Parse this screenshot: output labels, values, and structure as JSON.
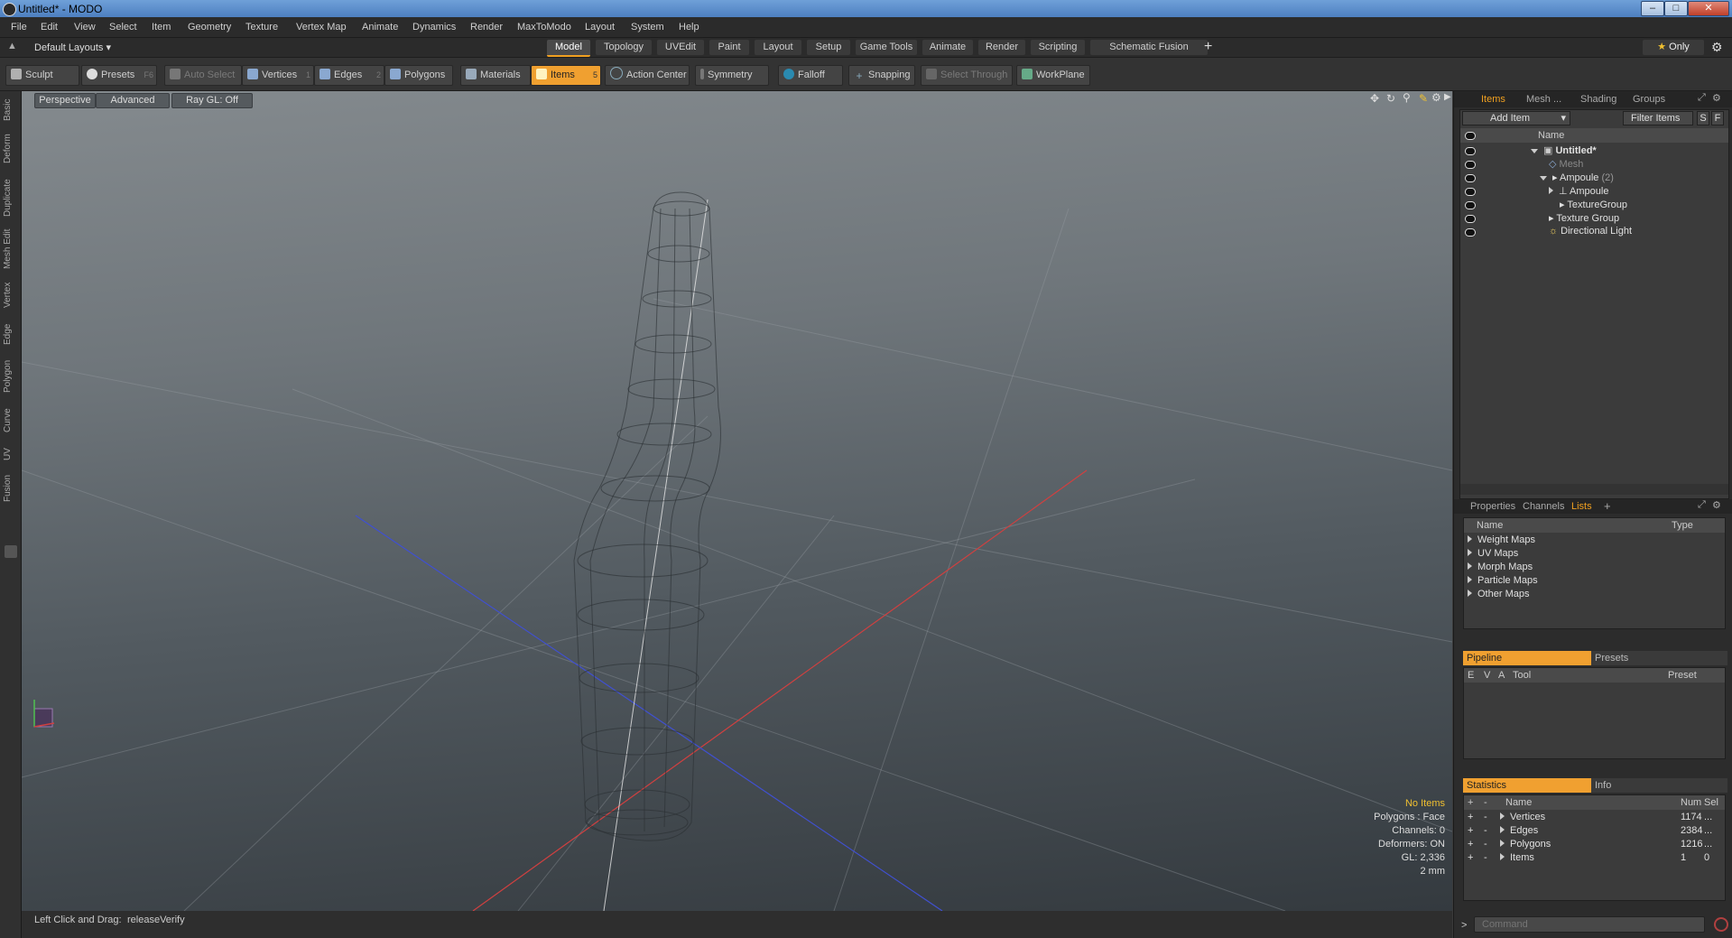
{
  "window": {
    "title": "Untitled* - MODO",
    "minimize": "–",
    "maximize": "□",
    "close": "✕"
  },
  "menu": [
    "File",
    "Edit",
    "View",
    "Select",
    "Item",
    "Geometry",
    "Texture",
    "Vertex Map",
    "Animate",
    "Dynamics",
    "Render",
    "MaxToModo",
    "Layout",
    "System",
    "Help"
  ],
  "layout_selector": "Default Layouts",
  "layout_tabs": [
    "Model",
    "Topology",
    "UVEdit",
    "Paint",
    "Layout",
    "Setup",
    "Game Tools",
    "Animate",
    "Render",
    "Scripting",
    "Schematic Fusion"
  ],
  "active_layout_tab": "Model",
  "only_button": "Only",
  "toolbar": {
    "sculpt": "Sculpt",
    "presets": "Presets",
    "presets_key": "F6",
    "auto_select": "Auto Select",
    "vertices": "Vertices",
    "vertices_key": "1",
    "edges": "Edges",
    "edges_key": "2",
    "polygons": "Polygons",
    "materials": "Materials",
    "items": "Items",
    "items_key": "5",
    "action_center": "Action Center",
    "symmetry": "Symmetry",
    "falloff": "Falloff",
    "snapping": "Snapping",
    "select_through": "Select Through",
    "workplane": "WorkPlane"
  },
  "left_tabs": [
    "Basic",
    "Deform",
    "Duplicate",
    "Mesh Edit",
    "Vertex",
    "Edge",
    "Polygon",
    "Curve",
    "UV",
    "Fusion"
  ],
  "viewport": {
    "view": "Perspective",
    "mode": "Advanced",
    "raygl": "Ray GL: Off",
    "stats": {
      "selection": "No Items",
      "polygons": "Polygons : Face",
      "channels": "Channels: 0",
      "deformers": "Deformers: ON",
      "gl": "GL: 2,336",
      "scale": "2 mm"
    }
  },
  "status_bar": {
    "hint": "Left Click and Drag:",
    "action": "releaseVerify"
  },
  "items_panel": {
    "tabs": [
      "Items",
      "Mesh ...",
      "Shading",
      "Groups"
    ],
    "add_item": "Add Item",
    "filter_items": "Filter Items",
    "s_btn": "S",
    "f_btn": "F",
    "col_name": "Name",
    "tree": [
      {
        "label": "Untitled*",
        "extra": ""
      },
      {
        "label": "Mesh",
        "extra": ""
      },
      {
        "label": "Ampoule",
        "extra": "(2)"
      },
      {
        "label": "Ampoule",
        "extra": ""
      },
      {
        "label": "TextureGroup",
        "extra": ""
      },
      {
        "label": "Texture Group",
        "extra": ""
      },
      {
        "label": "Directional Light",
        "extra": ""
      }
    ]
  },
  "lists_panel": {
    "tabs": [
      "Properties",
      "Channels",
      "Lists"
    ],
    "plus": "+",
    "col_name": "Name",
    "col_type": "Type",
    "rows": [
      "Weight Maps",
      "UV Maps",
      "Morph Maps",
      "Particle Maps",
      "Other Maps"
    ]
  },
  "pipeline_panel": {
    "tabs": [
      "Pipeline",
      "Presets"
    ],
    "col_e": "E",
    "col_v": "V",
    "col_a": "A",
    "col_tool": "Tool",
    "col_preset": "Preset"
  },
  "stats_panel": {
    "tabs": [
      "Statistics",
      "Info"
    ],
    "plus": "+",
    "minus": "-",
    "col_name": "Name",
    "col_num": "Num",
    "col_sel": "Sel",
    "rows": [
      {
        "name": "Vertices",
        "num": "1174",
        "sel": "..."
      },
      {
        "name": "Edges",
        "num": "2384",
        "sel": "..."
      },
      {
        "name": "Polygons",
        "num": "1216",
        "sel": "..."
      },
      {
        "name": "Items",
        "num": "1",
        "sel": "0"
      }
    ]
  },
  "command": {
    "prompt": ">",
    "placeholder": "Command"
  },
  "colors": {
    "accent": "#f0a030",
    "axis_x": "#d04040",
    "axis_y": "#e0e0e0",
    "axis_z": "#4050d0"
  }
}
